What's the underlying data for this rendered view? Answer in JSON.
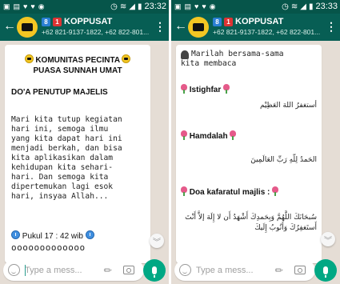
{
  "left": {
    "status": {
      "time": "23:32"
    },
    "header": {
      "title_badges": [
        "8",
        "1"
      ],
      "title": "KOPPUSAT",
      "subtitle": "+62 821-9137-1822, +62 822-801..."
    },
    "message": {
      "title_line1": "KOMUNITAS PECINTA",
      "title_line2": "PUASA SUNNAH UMAT",
      "heading": "DO'A PENUTUP MAJELIS",
      "body": "Mari kita tutup kegiatan\nhari ini, semoga ilmu\nyang kita dapat hari ini\nmenjadi berkah, dan bisa\nkita aplikasikan dalam\nkehidupan kita sehari-\nhari. Dan semoga kita\ndipertemukan lagi esok\nhari, insyaa Allah...",
      "time_label": "Pukul 17 : 42 wib",
      "circles": "ooooooooooooo"
    },
    "input": {
      "placeholder": "Type a mess..."
    }
  },
  "right": {
    "status": {
      "time": "23:33"
    },
    "header": {
      "title_badges": [
        "8",
        "1"
      ],
      "title": "KOPPUSAT",
      "subtitle": "+62 821-9137-1822, +62 822-801..."
    },
    "message": {
      "intro": "Marilah bersama-sama\nkita membaca",
      "istighfar_label": "Istighfar",
      "istighfar_arabic": "أستغفرُ اللهَ العَظِيْم",
      "hamdalah_label": "Hamdalah",
      "hamdalah_arabic": "الحَمدُ لِلّهِ رَبِّ العَالَمِينَ",
      "kafarat_label": "Doa kafaratul majlis :",
      "kafarat_arabic": "سُبحَانَكَ اللَّهُمَّ وَبِحَمدِكَ أَشْهَدُ أَن لا إِلَهَ إلاَّ أَنْتَ أَستَغفِرُكَ وَأَتُوبُ إِلَيكَ"
    },
    "input": {
      "placeholder": "Type a mess..."
    }
  },
  "colors": {
    "status_bar": "#06554a",
    "app_bar": "#075e54",
    "chat_bg": "#e5ddd5",
    "mic_button": "#00a884"
  }
}
